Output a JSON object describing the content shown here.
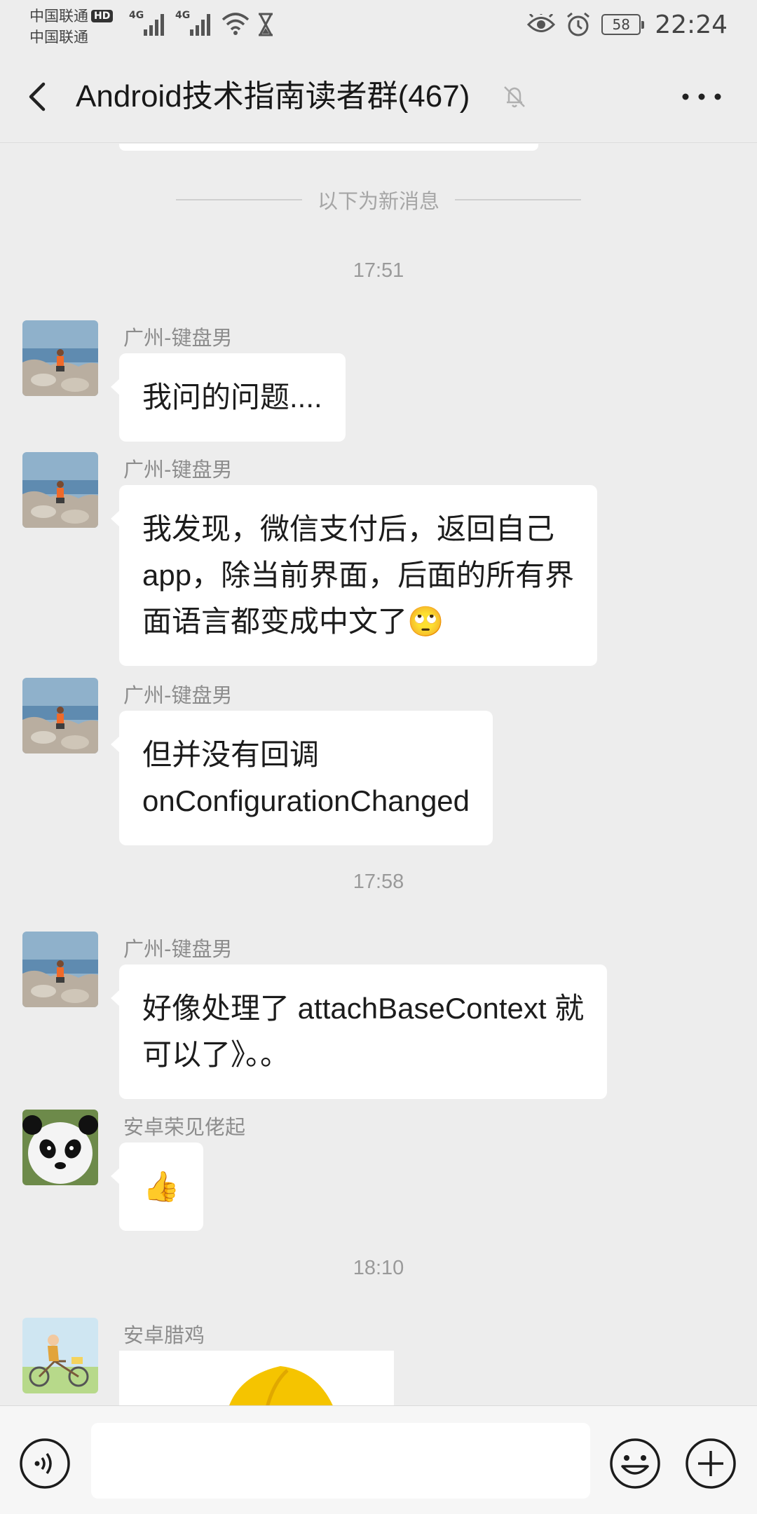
{
  "status_bar": {
    "carrier1": "中国联通",
    "hd_badge": "HD",
    "carrier2": "中国联通",
    "net1": "4G",
    "net2": "4G",
    "battery": "58",
    "time": "22:24"
  },
  "header": {
    "title": "Android技术指南读者群(467)"
  },
  "chat": {
    "new_messages_divider": "以下为新消息",
    "timestamps": [
      "17:51",
      "17:58",
      "18:10"
    ],
    "messages": [
      {
        "sender": "广州-键盘男",
        "lines": [
          "我问的问题...."
        ]
      },
      {
        "sender": "广州-键盘男",
        "lines": [
          "我发现，微信支付后，返回自己",
          "app，除当前界面，后面的所有界",
          "面语言都变成中文了"
        ],
        "emoji": "🙄"
      },
      {
        "sender": "广州-键盘男",
        "lines": [
          "但并没有回调",
          "onConfigurationChanged"
        ]
      },
      {
        "sender": "广州-键盘男",
        "lines": [
          "好像处理了 attachBaseContext 就",
          "可以了》。。"
        ]
      },
      {
        "sender": "安卓荣见佬起",
        "lines": [
          "👍"
        ]
      },
      {
        "sender": "安卓腊鸡",
        "image": "yellow-helmet"
      }
    ]
  },
  "input_bar": {
    "placeholder": ""
  },
  "colors": {
    "background": "#ededed",
    "bubble": "#ffffff",
    "secondary_text": "#8d8d8d"
  }
}
